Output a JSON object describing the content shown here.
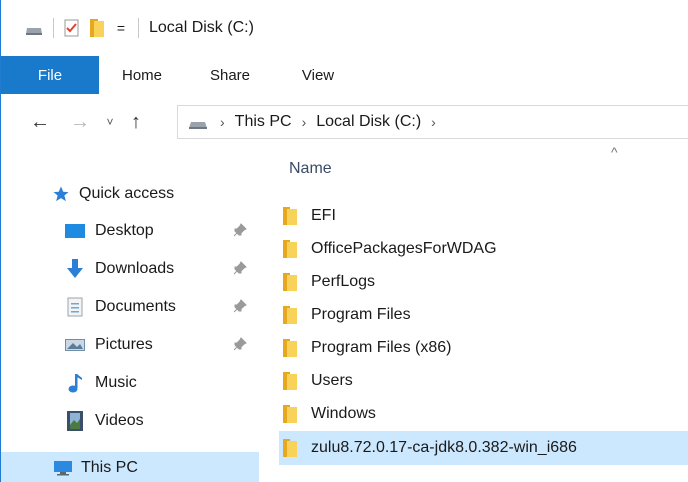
{
  "titlebar": {
    "title": "Local Disk (C:)",
    "icons": [
      "drive-icon",
      "properties-check-icon",
      "new-folder-icon",
      "customize-quick-access-icon"
    ],
    "dropdown_glyph": "="
  },
  "ribbon": {
    "tabs": [
      {
        "label": "File",
        "active": true
      },
      {
        "label": "Home"
      },
      {
        "label": "Share"
      },
      {
        "label": "View"
      }
    ]
  },
  "address": {
    "back_glyph": "←",
    "forward_glyph": "→",
    "recent_glyph": "˅",
    "up_glyph": "↑",
    "crumbs": [
      "This PC",
      "Local Disk (C:)"
    ],
    "separator": "›"
  },
  "nav": {
    "items": [
      {
        "label": "Quick access",
        "icon": "star-icon"
      },
      {
        "label": "Desktop",
        "icon": "desktop-icon",
        "pinned": true
      },
      {
        "label": "Downloads",
        "icon": "download-arrow-icon",
        "pinned": true
      },
      {
        "label": "Documents",
        "icon": "documents-icon",
        "pinned": true
      },
      {
        "label": "Pictures",
        "icon": "pictures-icon",
        "pinned": true
      },
      {
        "label": "Music",
        "icon": "music-note-icon"
      },
      {
        "label": "Videos",
        "icon": "videos-icon"
      },
      {
        "label": "This PC",
        "icon": "computer-icon",
        "selected": true
      }
    ],
    "pin_glyph": "📌"
  },
  "content": {
    "column_header": "Name",
    "sort_glyph": "^",
    "folders": [
      "EFI",
      "OfficePackagesForWDAG",
      "PerfLogs",
      "Program Files",
      "Program Files (x86)",
      "Users",
      "Windows",
      "zulu8.72.0.17-ca-jdk8.0.382-win_i686"
    ],
    "selected_index": 7
  },
  "colors": {
    "accent": "#1979ca",
    "selection": "#cce8ff",
    "folder_front": "#f9d25a",
    "folder_back": "#e6a81e"
  }
}
